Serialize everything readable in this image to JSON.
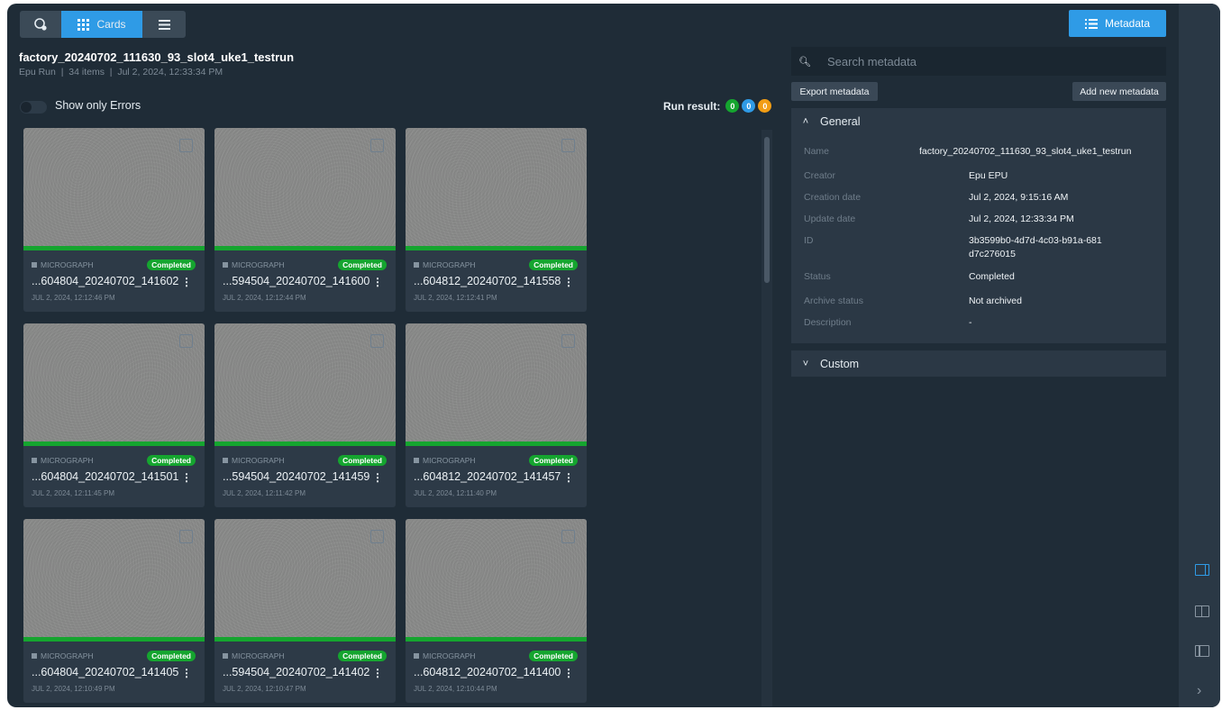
{
  "toolbar": {
    "cards_label": "Cards",
    "metadata_label": "Metadata",
    "icons": [
      "map-pin-icon",
      "grid-icon",
      "list-icon",
      "list-icon"
    ]
  },
  "run": {
    "title": "factory_20240702_111630_93_slot4_uke1_testrun",
    "subtitle": "Epu Run  |  34 items  |  Jul 2, 2024, 12:33:34 PM"
  },
  "filter": {
    "show_only_errors_label": "Show only Errors",
    "enabled": false
  },
  "run_result": {
    "label": "Run result:",
    "counts": [
      "0",
      "0",
      "0"
    ],
    "colors": [
      "#15a52f",
      "#2f9be6",
      "#f29d14"
    ]
  },
  "cards": [
    {
      "type": "MICROGRAPH",
      "status": "Completed",
      "name": "...604804_20240702_141602",
      "date": "JUL 2, 2024, 12:12:46 PM"
    },
    {
      "type": "MICROGRAPH",
      "status": "Completed",
      "name": "...594504_20240702_141600",
      "date": "JUL 2, 2024, 12:12:44 PM"
    },
    {
      "type": "MICROGRAPH",
      "status": "Completed",
      "name": "...604812_20240702_141558",
      "date": "JUL 2, 2024, 12:12:41 PM"
    },
    {
      "type": "MICROGRAPH",
      "status": "Completed",
      "name": "...604804_20240702_141501",
      "date": "JUL 2, 2024, 12:11:45 PM"
    },
    {
      "type": "MICROGRAPH",
      "status": "Completed",
      "name": "...594504_20240702_141459",
      "date": "JUL 2, 2024, 12:11:42 PM"
    },
    {
      "type": "MICROGRAPH",
      "status": "Completed",
      "name": "...604812_20240702_141457",
      "date": "JUL 2, 2024, 12:11:40 PM"
    },
    {
      "type": "MICROGRAPH",
      "status": "Completed",
      "name": "...604804_20240702_141405",
      "date": "JUL 2, 2024, 12:10:49 PM"
    },
    {
      "type": "MICROGRAPH",
      "status": "Completed",
      "name": "...594504_20240702_141402",
      "date": "JUL 2, 2024, 12:10:47 PM"
    },
    {
      "type": "MICROGRAPH",
      "status": "Completed",
      "name": "...604812_20240702_141400",
      "date": "JUL 2, 2024, 12:10:44 PM"
    }
  ],
  "metadata": {
    "search_placeholder": "Search metadata",
    "export_label": "Export metadata",
    "add_label": "Add new metadata",
    "general": {
      "title": "General",
      "expanded": true,
      "fields": [
        {
          "label": "Name",
          "value": "factory_20240702_111630_93_slot4_uke1_testrun"
        },
        {
          "label": "Creator",
          "value": "Epu EPU"
        },
        {
          "label": "Creation date",
          "value": "Jul 2, 2024, 9:15:16 AM"
        },
        {
          "label": "Update date",
          "value": "Jul 2, 2024, 12:33:34 PM"
        },
        {
          "label": "ID",
          "value": "3b3599b0-4d7d-4c03-b91a-681d7c276015"
        },
        {
          "label": "Status",
          "value": "Completed"
        },
        {
          "label": "Archive status",
          "value": "Not archived"
        },
        {
          "label": "Description",
          "value": "-"
        }
      ]
    },
    "custom": {
      "title": "Custom",
      "expanded": false
    }
  },
  "colors": {
    "accent": "#2f9be6",
    "success": "#15a52f",
    "warning": "#f29d14",
    "background": "#1f2c37"
  },
  "rail_icons": [
    "panel-right-icon",
    "panel-split-icon",
    "panel-left-icon",
    "chevron-right-icon"
  ]
}
